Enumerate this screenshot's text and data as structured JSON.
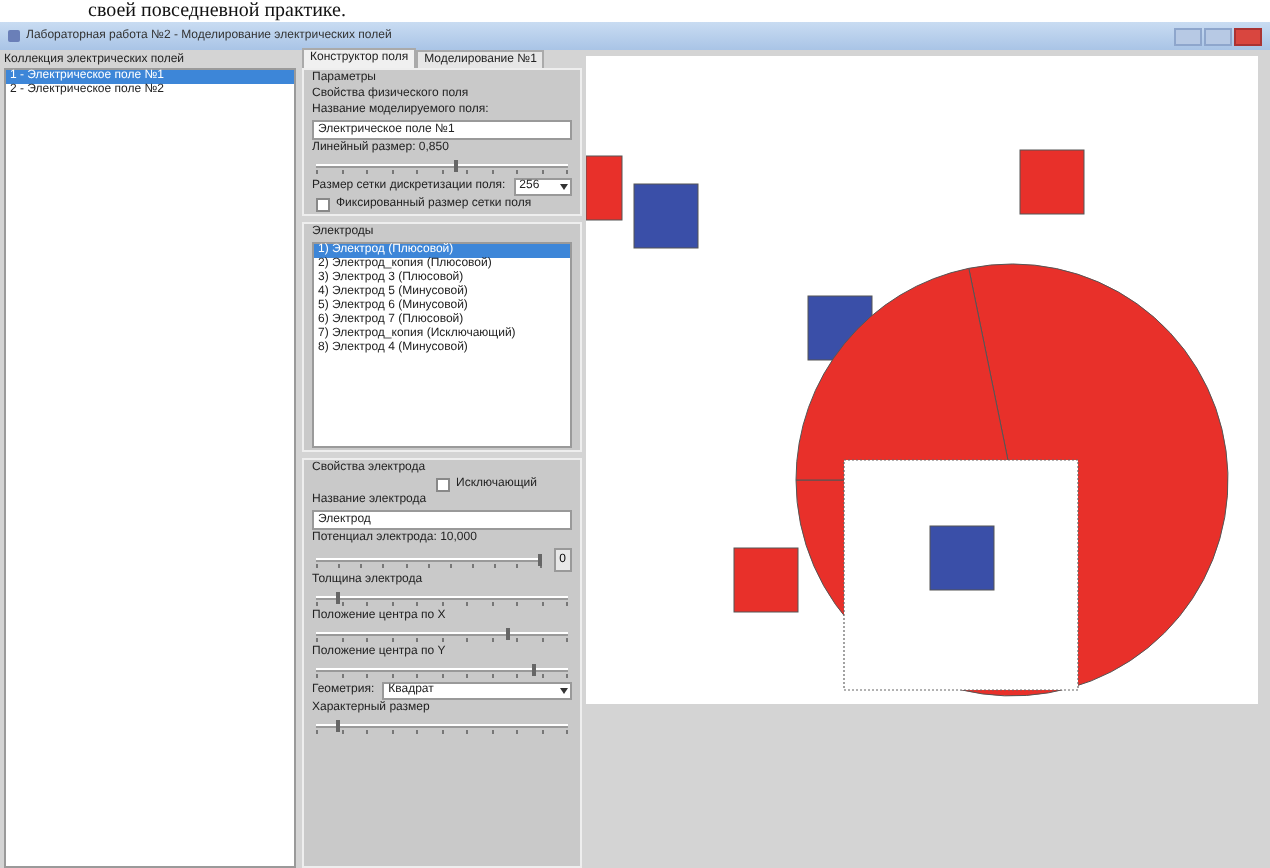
{
  "page_caption": "своей повседневной практике.",
  "window": {
    "title": "Лабораторная работа №2 - Моделирование электрических полей"
  },
  "collection": {
    "header": "Коллекция электрических полей",
    "items": [
      {
        "label": "1 - Электрическое поле №1",
        "selected": true
      },
      {
        "label": "2 - Электрическое поле №2",
        "selected": false
      }
    ]
  },
  "tabs": [
    {
      "label": "Конструктор поля",
      "selected": true
    },
    {
      "label": "Моделирование №1",
      "selected": false
    }
  ],
  "parameters": {
    "header": "Параметры",
    "subheader": "Свойства физического поля",
    "name_label": "Название моделируемого поля:",
    "name_value": "Электрическое поле №1",
    "size_label": "Линейный размер: 0,850",
    "size_slider": {
      "level": 0.55
    },
    "grid_label": "Размер сетки дискретизации поля:",
    "grid_value": "256",
    "fixed_grid": {
      "label": "Фиксированный размер сетки поля",
      "checked": false
    }
  },
  "electrodes": {
    "header": "Электроды",
    "items": [
      {
        "label": "1) Электрод (Плюсовой)",
        "selected": true
      },
      {
        "label": "2) Электрод_копия (Плюсовой)",
        "selected": false
      },
      {
        "label": "3) Электрод 3 (Плюсовой)",
        "selected": false
      },
      {
        "label": "4) Электрод 5 (Минусовой)",
        "selected": false
      },
      {
        "label": "5) Электрод 6 (Минусовой)",
        "selected": false
      },
      {
        "label": "6) Электрод 7 (Плюсовой)",
        "selected": false
      },
      {
        "label": "7) Электрод_копия (Исключающий)",
        "selected": false
      },
      {
        "label": "8) Электрод 4 (Минусовой)",
        "selected": false
      }
    ]
  },
  "electrode_props": {
    "header": "Свойства электрода",
    "exclusive": {
      "label": "Исключающий",
      "checked": false
    },
    "name_label": "Название электрода",
    "name_value": "Электрод",
    "potential_label": "Потенциал электрода: 10,000",
    "potential_slider": {
      "level": 0.98
    },
    "zero_button": "0",
    "sliders": [
      {
        "label": "Толщина электрода",
        "level": 0.1
      },
      {
        "label": "Положение центра по X",
        "level": 0.75
      },
      {
        "label": "Положение центра по Y",
        "level": 0.85
      }
    ],
    "geometry_label": "Геометрия:",
    "geometry_value": "Квадрат",
    "size_label": "Характерный размер",
    "size_slider": {
      "level": 0.1
    }
  },
  "canvas": {
    "shapes": [
      {
        "kind": "square",
        "color": "#e8302a"
      },
      {
        "kind": "square",
        "color": "#3a4fa8"
      },
      {
        "kind": "square",
        "color": "#e8302a"
      },
      {
        "kind": "square",
        "color": "#3a4fa8"
      },
      {
        "kind": "disc",
        "color": "#e8302a"
      },
      {
        "kind": "exclusion",
        "color": "#ffffff"
      },
      {
        "kind": "square",
        "color": "#3a4fa8"
      },
      {
        "kind": "square",
        "color": "#e8302a"
      }
    ]
  }
}
